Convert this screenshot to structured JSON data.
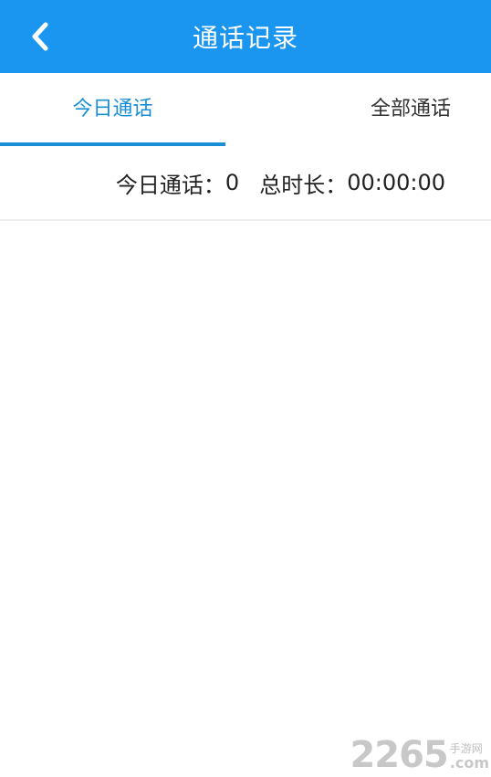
{
  "header": {
    "title": "通话记录",
    "back_icon": "chevron-left-icon"
  },
  "tabs": [
    {
      "label": "今日通话",
      "active": true
    },
    {
      "label": "全部通话",
      "active": false
    }
  ],
  "summary": {
    "today_label": "今日通话：",
    "today_count": "0",
    "duration_label": "总时长：",
    "duration_value": "00:00:00"
  },
  "watermark": {
    "number": "2265",
    "site_cn": "手游网",
    "site_en": ".com"
  },
  "colors": {
    "header_bg": "#1a96f0",
    "tab_active": "#1a8fd6"
  }
}
